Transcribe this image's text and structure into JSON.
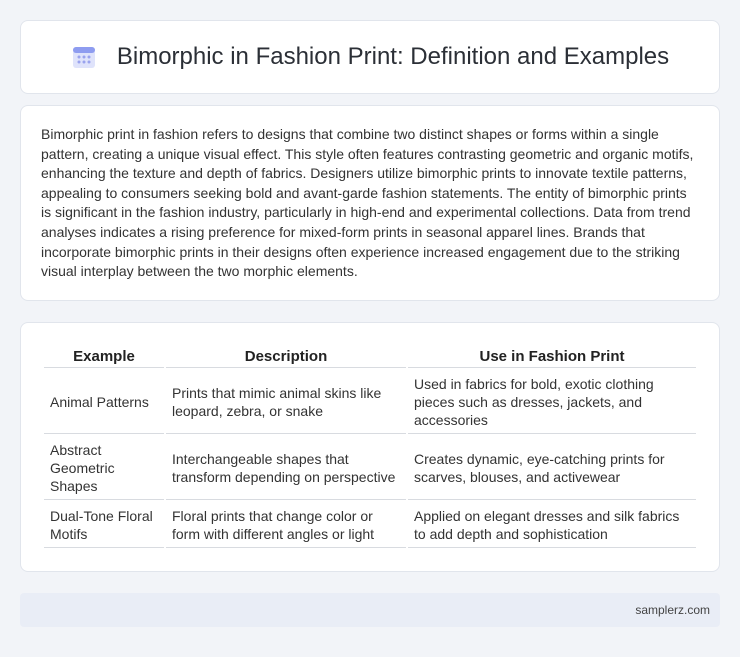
{
  "header": {
    "title": "Bimorphic in Fashion Print: Definition and Examples",
    "icon": "calendar-grid-icon"
  },
  "intro": {
    "text": "Bimorphic print in fashion refers to designs that combine two distinct shapes or forms within a single pattern, creating a unique visual effect. This style often features contrasting geometric and organic motifs, enhancing the texture and depth of fabrics. Designers utilize bimorphic prints to innovate textile patterns, appealing to consumers seeking bold and avant-garde fashion statements. The entity of bimorphic prints is significant in the fashion industry, particularly in high-end and experimental collections. Data from trend analyses indicates a rising preference for mixed-form prints in seasonal apparel lines. Brands that incorporate bimorphic prints in their designs often experience increased engagement due to the striking visual interplay between the two morphic elements."
  },
  "table": {
    "headers": [
      "Example",
      "Description",
      "Use in Fashion Print"
    ],
    "rows": [
      [
        "Animal Patterns",
        "Prints that mimic animal skins like leopard, zebra, or snake",
        "Used in fabrics for bold, exotic clothing pieces such as dresses, jackets, and accessories"
      ],
      [
        "Abstract Geometric Shapes",
        "Interchangeable shapes that transform depending on perspective",
        "Creates dynamic, eye-catching prints for scarves, blouses, and activewear"
      ],
      [
        "Dual-Tone Floral Motifs",
        "Floral prints that change color or form with different angles or light",
        "Applied on elegant dresses and silk fabrics to add depth and sophistication"
      ]
    ]
  },
  "footer": {
    "text": "samplerz.com"
  }
}
